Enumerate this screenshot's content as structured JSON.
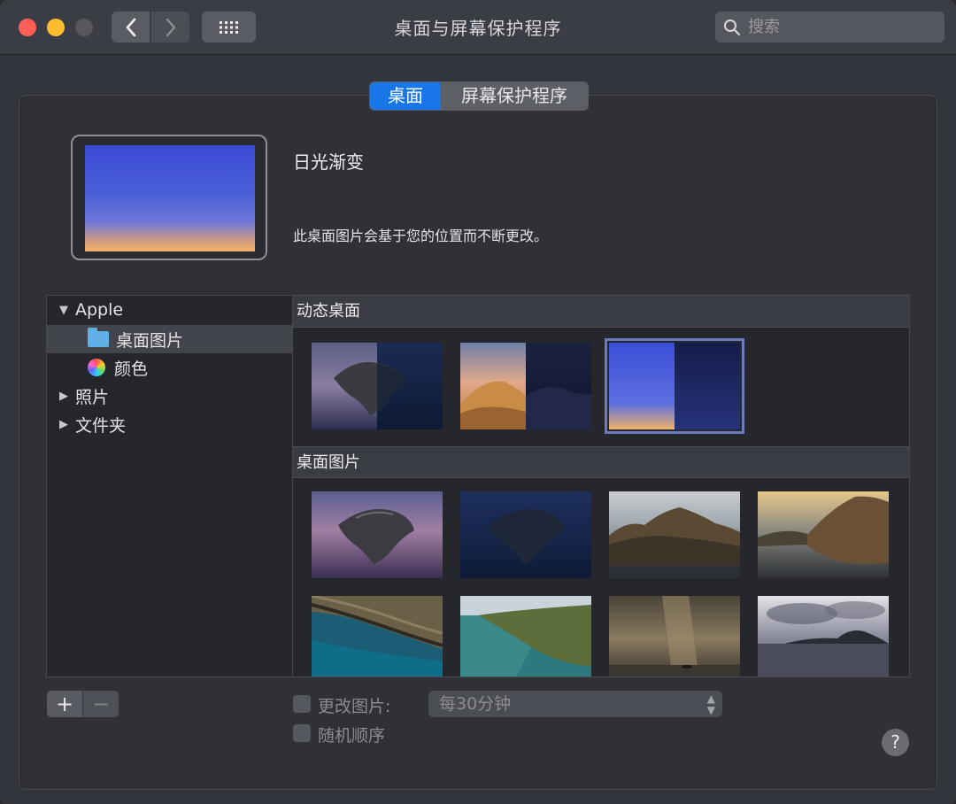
{
  "window": {
    "title": "桌面与屏幕保护程序"
  },
  "search": {
    "placeholder": "搜索"
  },
  "tabs": [
    {
      "label": "桌面",
      "active": true
    },
    {
      "label": "屏幕保护程序",
      "active": false
    }
  ],
  "current": {
    "name": "日光渐变",
    "description": "此桌面图片会基于您的位置而不断更改。"
  },
  "sidebar": {
    "group": "Apple",
    "items": [
      {
        "label": "桌面图片",
        "icon": "folder-icon",
        "selected": true
      },
      {
        "label": "颜色",
        "icon": "color-wheel-icon",
        "selected": false
      }
    ],
    "collapsed": [
      {
        "label": "照片"
      },
      {
        "label": "文件夹"
      }
    ]
  },
  "sections": {
    "dynamic": {
      "title": "动态桌面"
    },
    "pictures": {
      "title": "桌面图片"
    }
  },
  "controls": {
    "change_picture_label": "更改图片:",
    "interval": "每30分钟",
    "random_label": "随机顺序",
    "change_picture_checked": false,
    "random_checked": false
  },
  "colors": {
    "accent": "#1976e8",
    "background": "#33353c"
  }
}
